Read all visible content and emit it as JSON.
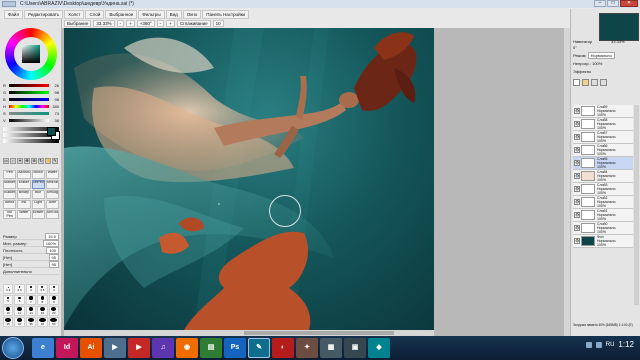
{
  "window": {
    "title": "C:\\Users\\ABRAZIV\\Desktop\\шедевр\\Ундина.sai (*)"
  },
  "menus": [
    "Файл",
    "Редактировать",
    "Холст",
    "Слой",
    "Выбранное",
    "Фильтры",
    "Вид",
    "Окно",
    "Панель Настройки"
  ],
  "toolbar": {
    "chips": [
      "Выбрание",
      "33.33%",
      "-",
      "+",
      "+360°",
      "-",
      "+",
      "Сглаживание",
      "10"
    ]
  },
  "color": {
    "rgb": [
      {
        "label": "R",
        "value": "26"
      },
      {
        "label": "G",
        "value": "98"
      },
      {
        "label": "B",
        "value": "98"
      }
    ],
    "hsv": [
      {
        "label": "H",
        "value": "180"
      },
      {
        "label": "S",
        "value": "73"
      },
      {
        "label": "V",
        "value": "38"
      }
    ],
    "foreground_hex": "#0c4d4d"
  },
  "brushes": [
    {
      "label": "Pen"
    },
    {
      "label": "AirBrush"
    },
    {
      "label": "Brush"
    },
    {
      "label": "Water"
    },
    {
      "label": "Marker"
    },
    {
      "label": "Eraser"
    },
    {
      "label": "SelPen"
    },
    {
      "label": "SelEras"
    },
    {
      "label": "Bucket"
    },
    {
      "label": "Binary"
    },
    {
      "label": "Blur"
    },
    {
      "label": "Smudge"
    },
    {
      "label": "Blend"
    },
    {
      "label": "Ink"
    },
    {
      "label": "Light"
    },
    {
      "label": "Airbr"
    },
    {
      "label": "Ink Pen"
    },
    {
      "label": "Water"
    },
    {
      "label": "Eraser"
    },
    {
      "label": "SelTool"
    }
  ],
  "brush_props": [
    {
      "label": "Размер",
      "value": "15.0"
    },
    {
      "label": "Мин. размер",
      "value": "100%"
    },
    {
      "label": "Плотность",
      "value": "100"
    },
    {
      "label": "[Нет]",
      "value": "95"
    },
    {
      "label": "[Нет]",
      "value": "95"
    },
    {
      "label": "Дополнительно",
      "value": ""
    }
  ],
  "brush_sizes": [
    "2.3",
    "2.6",
    "3",
    "3.5",
    "4",
    "5",
    "6",
    "7",
    "8",
    "9",
    "10",
    "12",
    "14",
    "16",
    "20",
    "25",
    "30",
    "35",
    "40",
    "50"
  ],
  "navigator": {
    "label": "Навигатор",
    "zoom": "33.33%",
    "angle": "0°"
  },
  "layer_panel": {
    "mode_label": "Режим",
    "mode_value": "Нормально",
    "opacity_label": "Непрозр.",
    "opacity_value": "100%",
    "effects_label": "Эффекты"
  },
  "layers": [
    {
      "name": "Слой9",
      "blend": "Нормально",
      "opacity": "100%"
    },
    {
      "name": "Слой8",
      "blend": "Нормально",
      "opacity": "100%"
    },
    {
      "name": "Слой7",
      "blend": "Нормально",
      "opacity": "100%"
    },
    {
      "name": "Слой6",
      "blend": "Нормально",
      "opacity": "100%"
    },
    {
      "name": "Слой5",
      "blend": "Нормально",
      "opacity": "100%"
    },
    {
      "name": "Слой4",
      "blend": "Нормально",
      "opacity": "100%"
    },
    {
      "name": "Слой3",
      "blend": "Нормально",
      "opacity": "100%"
    },
    {
      "name": "Слой2",
      "blend": "Нормально",
      "opacity": "100%"
    },
    {
      "name": "Слой1",
      "blend": "Нормально",
      "opacity": "100%"
    },
    {
      "name": "Слой0",
      "blend": "Нормально",
      "opacity": "100%"
    },
    {
      "name": "Фон",
      "blend": "Нормально",
      "opacity": "100%"
    }
  ],
  "status": "Загрузка памяти:40% (545MB)   1:1:00 (E)",
  "taskbar": {
    "apps": [
      {
        "label": "e",
        "color": "#3d7fd1"
      },
      {
        "label": "Id",
        "color": "#c2185b"
      },
      {
        "label": "Ai",
        "color": "#e65100"
      },
      {
        "label": "▶",
        "color": "#4e6e8e"
      },
      {
        "label": "▶",
        "color": "#c62828"
      },
      {
        "label": "♫",
        "color": "#5e35b1"
      },
      {
        "label": "◉",
        "color": "#ef6c00"
      },
      {
        "label": "▤",
        "color": "#2e7d32"
      },
      {
        "label": "Ps",
        "color": "#1565c0"
      },
      {
        "label": "✎",
        "color": "#0f6e8c"
      },
      {
        "label": "◐",
        "color": "#b71c1c"
      },
      {
        "label": "✦",
        "color": "#6d4c41"
      },
      {
        "label": "▦",
        "color": "#455a64"
      },
      {
        "label": "▣",
        "color": "#37474f"
      },
      {
        "label": "◆",
        "color": "#00838f"
      }
    ],
    "lang": "RU",
    "time": "1:12"
  }
}
